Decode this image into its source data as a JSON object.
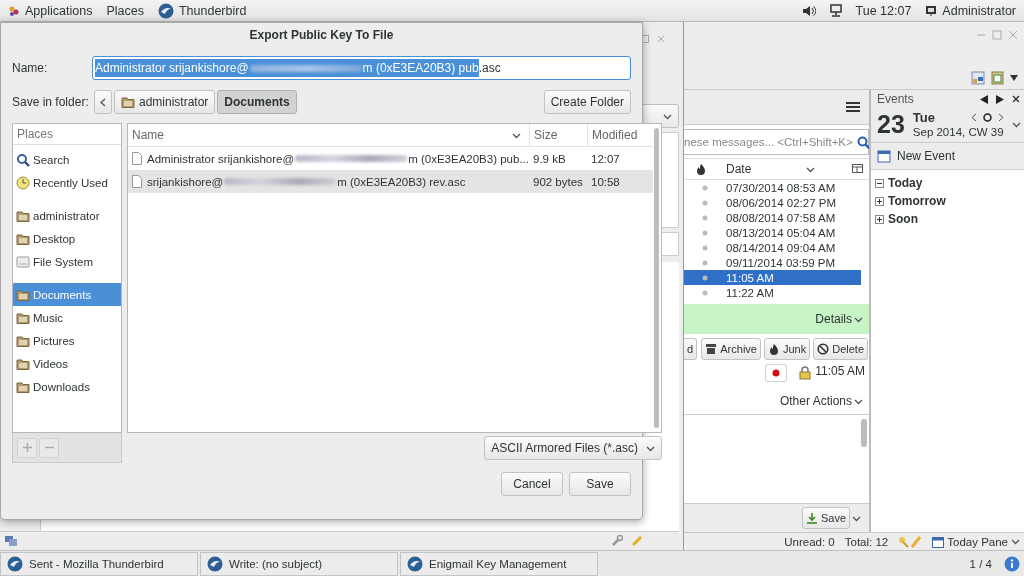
{
  "top_bar": {
    "menus": [
      "Applications",
      "Places"
    ],
    "app": "Thunderbird",
    "clock": "Tue 12:07",
    "user": "Administrator"
  },
  "dialog": {
    "title": "Export Public Key To File",
    "name_label": "Name:",
    "name_field": {
      "selected_start": "Administrator srijankishore@",
      "selected_end": "m (0xE3EA20B3) pub",
      "unselected": ".asc"
    },
    "folder_label": "Save in folder:",
    "path": [
      {
        "label": "administrator",
        "kind": "folder",
        "selected": false
      },
      {
        "label": "Documents",
        "kind": "plain",
        "selected": true
      }
    ],
    "create_folder": "Create Folder",
    "places": {
      "header": "Places",
      "groups": [
        [
          {
            "label": "Search",
            "kind": "search",
            "selected": false
          },
          {
            "label": "Recently Used",
            "kind": "recent",
            "selected": false
          }
        ],
        [
          {
            "label": "administrator",
            "kind": "folder",
            "selected": false
          },
          {
            "label": "Desktop",
            "kind": "folder",
            "selected": false
          },
          {
            "label": "File System",
            "kind": "drive",
            "selected": false
          }
        ],
        [
          {
            "label": "Documents",
            "kind": "folder",
            "selected": true
          },
          {
            "label": "Music",
            "kind": "folder",
            "selected": false
          },
          {
            "label": "Pictures",
            "kind": "folder",
            "selected": false
          },
          {
            "label": "Videos",
            "kind": "folder",
            "selected": false
          },
          {
            "label": "Downloads",
            "kind": "folder",
            "selected": false
          }
        ]
      ]
    },
    "file_list": {
      "columns": [
        "Name",
        "Size",
        "Modified"
      ],
      "rows": [
        {
          "name_start": "Administrator srijankishore@",
          "name_end": "m (0xE3EA20B3) pub...",
          "size": "9.9 kB",
          "modified": "12:07",
          "selected": false
        },
        {
          "name_start": "srijankishore@",
          "name_end": "m (0xE3EA20B3) rev.asc",
          "size": "902 bytes",
          "modified": "10:58",
          "selected": true
        }
      ]
    },
    "filter": "ASCII Armored Files (*.asc)",
    "buttons": [
      "Cancel",
      "Save"
    ]
  },
  "mail": {
    "search_placeholder": "nese messages... <Ctrl+Shift+K>",
    "date_column": "Date",
    "rows": [
      {
        "date": "07/30/2014 08:53 AM",
        "selected": false
      },
      {
        "date": "08/06/2014 02:27 PM",
        "selected": false
      },
      {
        "date": "08/08/2014 07:58 AM",
        "selected": false
      },
      {
        "date": "08/13/2014 05:04 AM",
        "selected": false
      },
      {
        "date": "08/14/2014 09:04 AM",
        "selected": false
      },
      {
        "date": "09/11/2014 03:59 PM",
        "selected": false
      },
      {
        "date": "11:05 AM",
        "selected": true
      },
      {
        "date": "11:22 AM",
        "selected": false
      }
    ],
    "details": "Details",
    "actions": [
      {
        "label": "d",
        "kind": "plain"
      },
      {
        "label": "Archive",
        "kind": "archive"
      },
      {
        "label": "Junk",
        "kind": "junk"
      },
      {
        "label": "Delete",
        "kind": "delete"
      }
    ],
    "time": "11:05 AM",
    "other_actions": "Other Actions",
    "save": "Save"
  },
  "events": {
    "title": "Events",
    "day": "23",
    "weekday": "Tue",
    "month": "Sep 2014, CW 39",
    "new_event": "New Event",
    "groups": [
      {
        "label": "Today",
        "expanded": true
      },
      {
        "label": "Tomorrow",
        "expanded": false
      },
      {
        "label": "Soon",
        "expanded": false
      }
    ]
  },
  "status": {
    "unread": "Unread: 0",
    "total": "Total: 12",
    "today_pane": "Today Pane"
  },
  "taskbar": {
    "tasks": [
      "Sent - Mozilla Thunderbird",
      "Write: (no subject)",
      "Enigmail Key Management"
    ],
    "workspace": "1 / 4"
  }
}
